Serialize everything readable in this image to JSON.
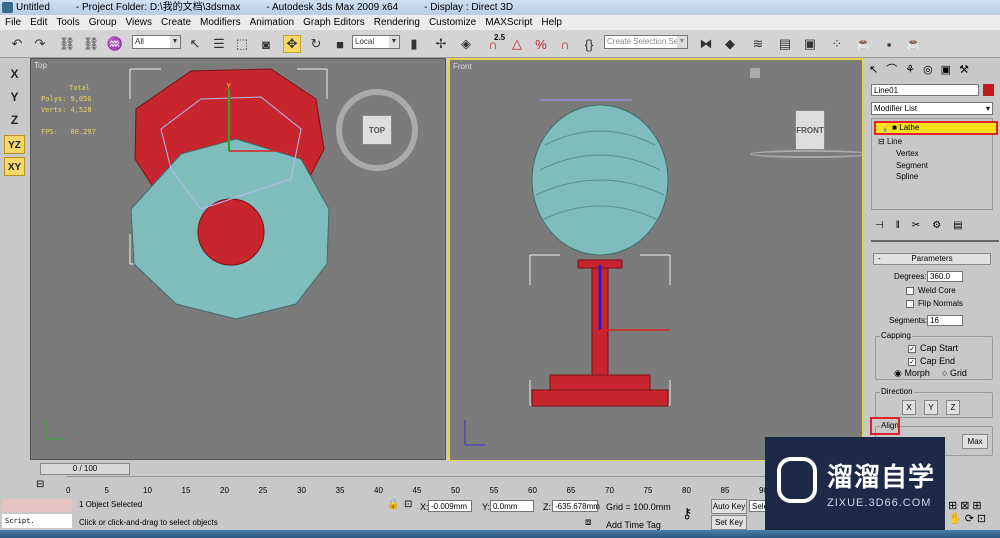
{
  "titlebar": {
    "doc": "Untitled",
    "project": "- Project Folder: D:\\我的文档\\3dsmax",
    "app": "- Autodesk 3ds Max  2009 x64",
    "display": "- Display : Direct 3D"
  },
  "menu": [
    "File",
    "Edit",
    "Tools",
    "Group",
    "Views",
    "Create",
    "Modifiers",
    "Animation",
    "Graph Editors",
    "Rendering",
    "Customize",
    "MAXScript",
    "Help"
  ],
  "toolbar": {
    "filter": "All",
    "coord": "Local",
    "snap_angle": "2.5",
    "selection_set_placeholder": "Create Selection Set"
  },
  "axis_buttons": [
    "X",
    "Y",
    "Z",
    "YZ",
    "XY"
  ],
  "viewports": {
    "top": {
      "label": "Top",
      "cube_label": "TOP",
      "stats": {
        "total": "Total",
        "polys": "Polys: 9,056",
        "verts": "Verts: 4,528",
        "fps": "FPS:   80.297"
      }
    },
    "front": {
      "label": "Front",
      "cube_label": "FRONT"
    }
  },
  "command_panel": {
    "object_name": "Line01",
    "object_color": "#c41a1a",
    "modifier_list": "Modifier List",
    "stack": [
      {
        "label": "Lathe",
        "highlighted": true
      },
      {
        "label": "Line"
      },
      {
        "label": "Vertex"
      },
      {
        "label": "Segment"
      },
      {
        "label": "Spline"
      }
    ],
    "parameters": {
      "title": "Parameters",
      "degrees_label": "Degrees:",
      "degrees": "360.0",
      "weld_core": "Weld Core",
      "weld_core_checked": false,
      "flip_normals": "Flip Normals",
      "flip_normals_checked": false,
      "segments_label": "Segments:",
      "segments": "16",
      "capping": {
        "title": "Capping",
        "cap_start": "Cap Start",
        "cap_start_checked": true,
        "cap_end": "Cap End",
        "cap_end_checked": true,
        "morph": "Morph",
        "grid": "Grid",
        "selected": "Morph"
      },
      "direction": {
        "title": "Direction",
        "buttons": [
          "X",
          "Y",
          "Z"
        ]
      },
      "align": {
        "title": "Align",
        "max": "Max"
      }
    }
  },
  "timeline": {
    "frame": "0 / 100",
    "ticks": [
      "0",
      "5",
      "10",
      "15",
      "20",
      "25",
      "30",
      "35",
      "40",
      "45",
      "50",
      "55",
      "60",
      "65",
      "70",
      "75",
      "80",
      "85",
      "90"
    ]
  },
  "status": {
    "script": "Script.",
    "selected": "1 Object Selected",
    "prompt": "Click or click-and-drag to select objects",
    "x_label": "X:",
    "x": "-0.009mm",
    "y_label": "Y:",
    "y": "0.0mm",
    "z_label": "Z:",
    "z": "-635.678mm",
    "grid": "Grid = 100.0mm",
    "auto_key": "Auto Key",
    "set_key": "Set Key",
    "selected_dropdown": "Sele",
    "add_time_tag": "Add Time Tag"
  },
  "watermark": {
    "name": "溜溜自学",
    "url": "ZIXUE.3D66.COM"
  },
  "colors": {
    "highlight": "#f6e020",
    "callout": "#e0202a",
    "object_red": "#c7262e",
    "object_teal": "#7fbcbc"
  }
}
